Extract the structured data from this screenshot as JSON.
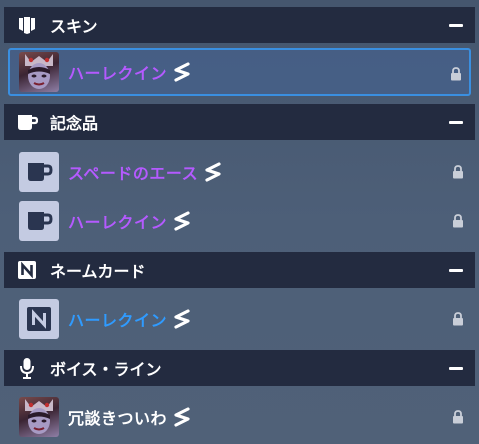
{
  "sections": [
    {
      "title": "スキン",
      "items": [
        {
          "name": "ハーレクイン",
          "selected": true
        }
      ]
    },
    {
      "title": "記念品",
      "items": [
        {
          "name": "スペードのエース"
        },
        {
          "name": "ハーレクイン"
        }
      ]
    },
    {
      "title": "ネームカード",
      "items": [
        {
          "name": "ハーレクイン"
        }
      ]
    },
    {
      "title": "ボイス・ライン",
      "items": [
        {
          "name": "冗談きついわ"
        }
      ]
    }
  ],
  "colors": {
    "section_header_bg": "#232b40",
    "selected_border": "#3a8fe0",
    "rarity_epic": "#b45aff",
    "rarity_rare": "#2f9bff",
    "rarity_common": "#ffffff"
  }
}
